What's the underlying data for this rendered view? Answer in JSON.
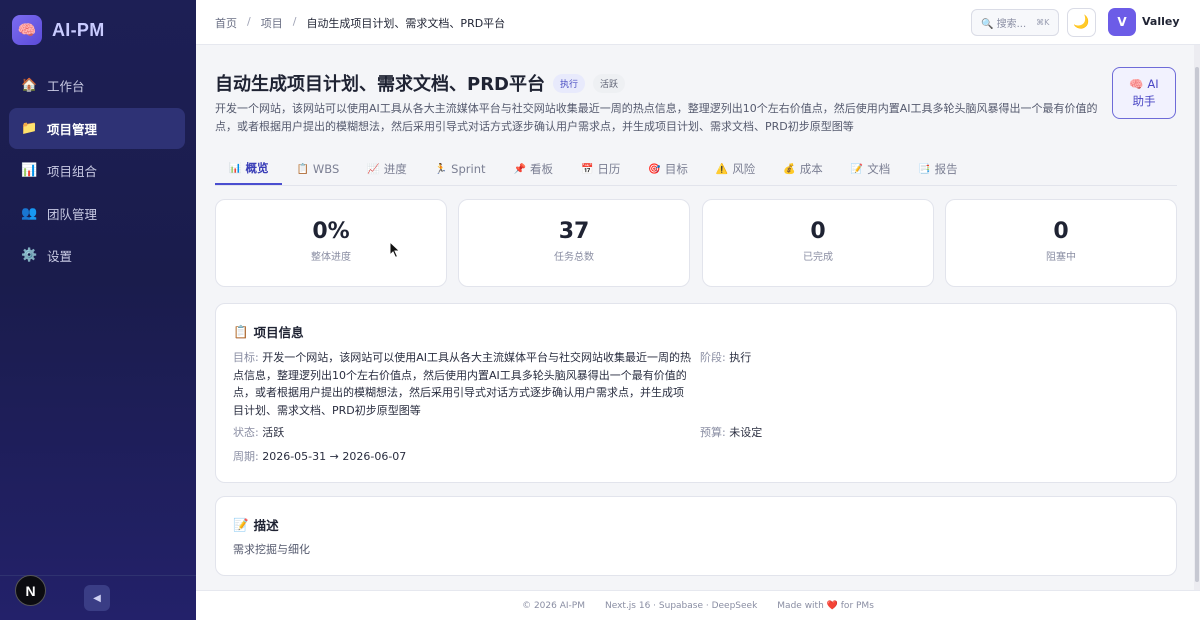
{
  "brand": {
    "name": "AI-PM",
    "logo_icon": "brain-icon"
  },
  "sidebar": {
    "items": [
      {
        "label": "工作台",
        "icon": "house-icon",
        "glyph": "🏠",
        "active": false
      },
      {
        "label": "项目管理",
        "icon": "folder-icon",
        "glyph": "📁",
        "active": true
      },
      {
        "label": "项目组合",
        "icon": "bar-chart-icon",
        "glyph": "📊",
        "active": false
      },
      {
        "label": "团队管理",
        "icon": "people-icon",
        "glyph": "👥",
        "active": false
      },
      {
        "label": "设置",
        "icon": "gear-icon",
        "glyph": "⚙️",
        "active": false
      }
    ],
    "next_badge": "N",
    "collapse_glyph": "◀"
  },
  "topbar": {
    "breadcrumb": [
      "首页",
      "项目",
      "自动生成项目计划、需求文档、PRD平台"
    ],
    "breadcrumb_sep": "/",
    "search_placeholder": "🔍 搜索...",
    "search_shortcut": "⌘K",
    "theme_glyph": "🌙",
    "avatar_initial": "V",
    "user_name": "Valley"
  },
  "project": {
    "title": "自动生成项目计划、需求文档、PRD平台",
    "phase_badge": "执行",
    "status_badge": "活跃",
    "description": "开发一个网站，该网站可以使用AI工具从各大主流媒体平台与社交网站收集最近一周的热点信息，整理逻列出10个左右价值点，然后使用内置AI工具多轮头脑风暴得出一个最有价值的点，或者根据用户提出的模糊想法，然后采用引导式对话方式逐步确认用户需求点，并生成项目计划、需求文档、PRD初步原型图等",
    "ai_button_line1": "🧠 AI",
    "ai_button_line2": "助手"
  },
  "tabs": [
    {
      "glyph": "📊",
      "label": "概览",
      "active": true
    },
    {
      "glyph": "📋",
      "label": "WBS",
      "active": false
    },
    {
      "glyph": "📈",
      "label": "进度",
      "active": false
    },
    {
      "glyph": "🏃",
      "label": "Sprint",
      "active": false
    },
    {
      "glyph": "📌",
      "label": "看板",
      "active": false
    },
    {
      "glyph": "📅",
      "label": "日历",
      "active": false
    },
    {
      "glyph": "🎯",
      "label": "目标",
      "active": false
    },
    {
      "glyph": "⚠️",
      "label": "风险",
      "active": false
    },
    {
      "glyph": "💰",
      "label": "成本",
      "active": false
    },
    {
      "glyph": "📝",
      "label": "文档",
      "active": false
    },
    {
      "glyph": "📑",
      "label": "报告",
      "active": false
    }
  ],
  "stats": [
    {
      "value": "0%",
      "label": "整体进度"
    },
    {
      "value": "37",
      "label": "任务总数"
    },
    {
      "value": "0",
      "label": "已完成"
    },
    {
      "value": "0",
      "label": "阻塞中"
    }
  ],
  "info_panel": {
    "title_glyph": "📋",
    "title": "项目信息",
    "goal_label": "目标:",
    "goal_value": "开发一个网站，该网站可以使用AI工具从各大主流媒体平台与社交网站收集最近一周的热点信息，整理逻列出10个左右价值点，然后使用内置AI工具多轮头脑风暴得出一个最有价值的点，或者根据用户提出的模糊想法，然后采用引导式对话方式逐步确认用户需求点，并生成项目计划、需求文档、PRD初步原型图等",
    "phase_label": "阶段:",
    "phase_value": "执行",
    "status_label": "状态:",
    "status_value": "活跃",
    "budget_label": "预算:",
    "budget_value": "未设定",
    "period_label": "周期:",
    "period_value": "2026-05-31 → 2026-06-07"
  },
  "desc_panel": {
    "title_glyph": "📝",
    "title": "描述",
    "content": "需求挖掘与细化"
  },
  "footer": {
    "copyright": "© 2026 AI-PM",
    "stack": "Next.js 16 · Supabase · DeepSeek",
    "made_prefix": "Made with",
    "heart": "❤️",
    "made_suffix": "for PMs"
  },
  "colors": {
    "sidebar_bg": "#1d1f55",
    "accent": "#4a4ed0",
    "avatar_bg": "#6c5ce7"
  }
}
